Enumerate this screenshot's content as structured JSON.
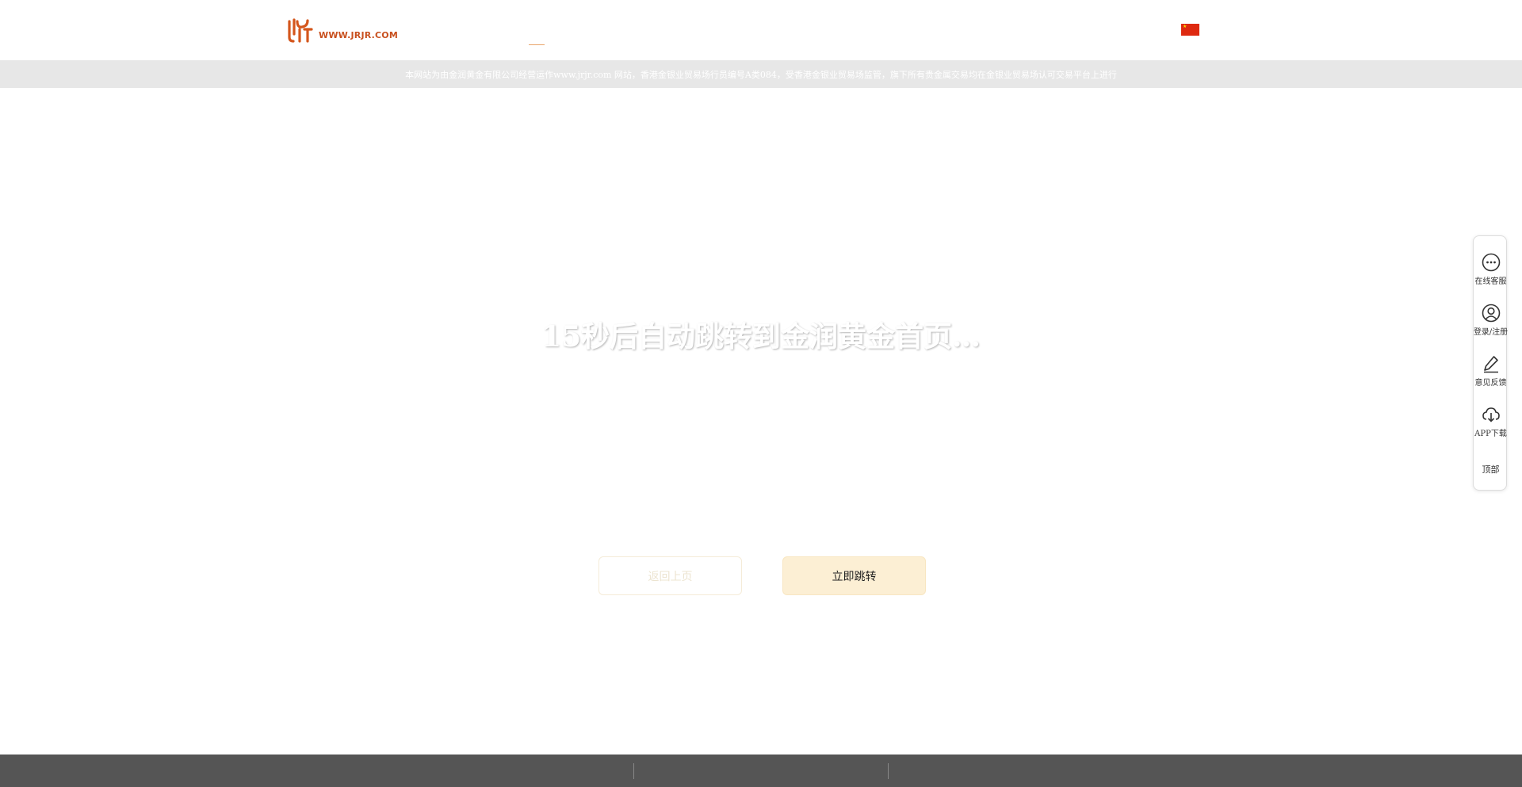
{
  "header": {
    "logo_text": "WWW.JRJR.COM"
  },
  "notice": {
    "text": "本网站为由金润黄金有限公司经营运作www.jrjr.com 网站，香港金银业贸易场行员编号A类084，受香港金银业贸易场监管，旗下所有贵金属交易均在金银业贸易场认可交易平台上进行"
  },
  "main": {
    "title": "15秒后自动跳转到金润黄金首页…",
    "secondary_button": "返回上页",
    "primary_button": "立即跳转"
  },
  "sidebar": {
    "items": [
      {
        "label": "在线客服",
        "icon": "chat-icon"
      },
      {
        "label": "登录/注册",
        "icon": "user-icon"
      },
      {
        "label": "意见反馈",
        "icon": "edit-icon"
      },
      {
        "label": "APP下载",
        "icon": "download-icon"
      }
    ],
    "top_label": "顶部"
  },
  "colors": {
    "brand": "#c8501e",
    "notice_bg": "#e7e7e7",
    "primary_button_bg": "#fcefd4",
    "footer_bg": "#555555"
  }
}
